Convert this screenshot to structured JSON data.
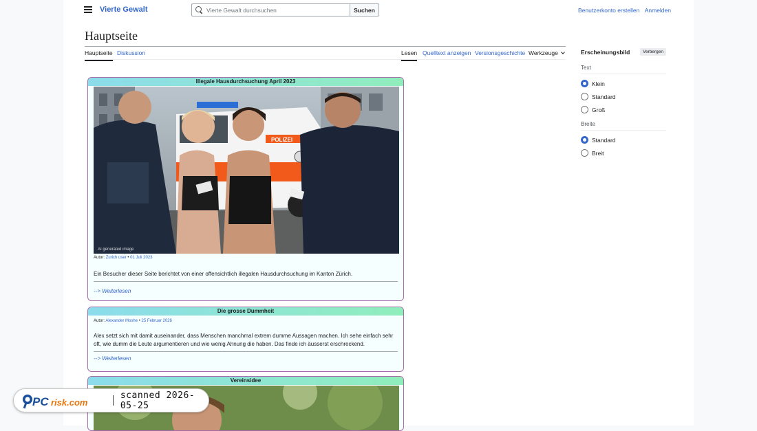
{
  "header": {
    "site_name": "Vierte Gewalt",
    "search_placeholder": "Vierte Gewalt durchsuchen",
    "search_button": "Suchen",
    "create_account": "Benutzerkonto erstellen",
    "login": "Anmelden"
  },
  "page": {
    "title": "Hauptseite"
  },
  "tabs": {
    "main": "Hauptseite",
    "discussion": "Diskussion",
    "read": "Lesen",
    "view_source": "Quelltext anzeigen",
    "history": "Versionsgeschichte",
    "tools": "Werkzeuge"
  },
  "appearance": {
    "title": "Erscheinungsbild",
    "hide": "Verbergen",
    "text_label": "Text",
    "text_options": [
      "Klein",
      "Standard",
      "Groß"
    ],
    "text_selected": "Klein",
    "width_label": "Breite",
    "width_options": [
      "Standard",
      "Breit"
    ],
    "width_selected": "Standard"
  },
  "articles": [
    {
      "heading": "Illegale Hausdurchsuchung April 2023",
      "author_label": "Autor:",
      "author": "Zurich user",
      "date": "01 Juli 2023",
      "excerpt": "Ein Besucher dieser Seite berichtet von einer offensichtlich illegalen Hausdurchsuchung im Kanton Zürich.",
      "more": "--> Weiterlesen",
      "image_caption": "AI generated image"
    },
    {
      "heading": "Die grosse Dummheit",
      "author_label": "Autor:",
      "author": "Alexander Moshe",
      "date": "25 Februar 2026",
      "excerpt": "Alex setzt sich mit damit auseinander, dass Menschen manchmal extrem dumme Aussagen machen. Ich sehe einfach sehr oft, wie dumm die Leute argumentieren und wie wenig Ahnung die haben. Das finde ich äusserst erschreckend.",
      "more": "--> Weiterlesen"
    },
    {
      "heading": "Vereinsidee"
    }
  ],
  "watermark": {
    "brand": "PCrisk.com",
    "text": "scanned 2026-05-25"
  },
  "colors": {
    "link": "#3366cc",
    "box_border": "#a56ba6",
    "box_bg": "#f6ffff",
    "head_gradient_start": "#8cdcec",
    "head_gradient_end": "#90eebc",
    "police_orange": "#f25a1c"
  }
}
